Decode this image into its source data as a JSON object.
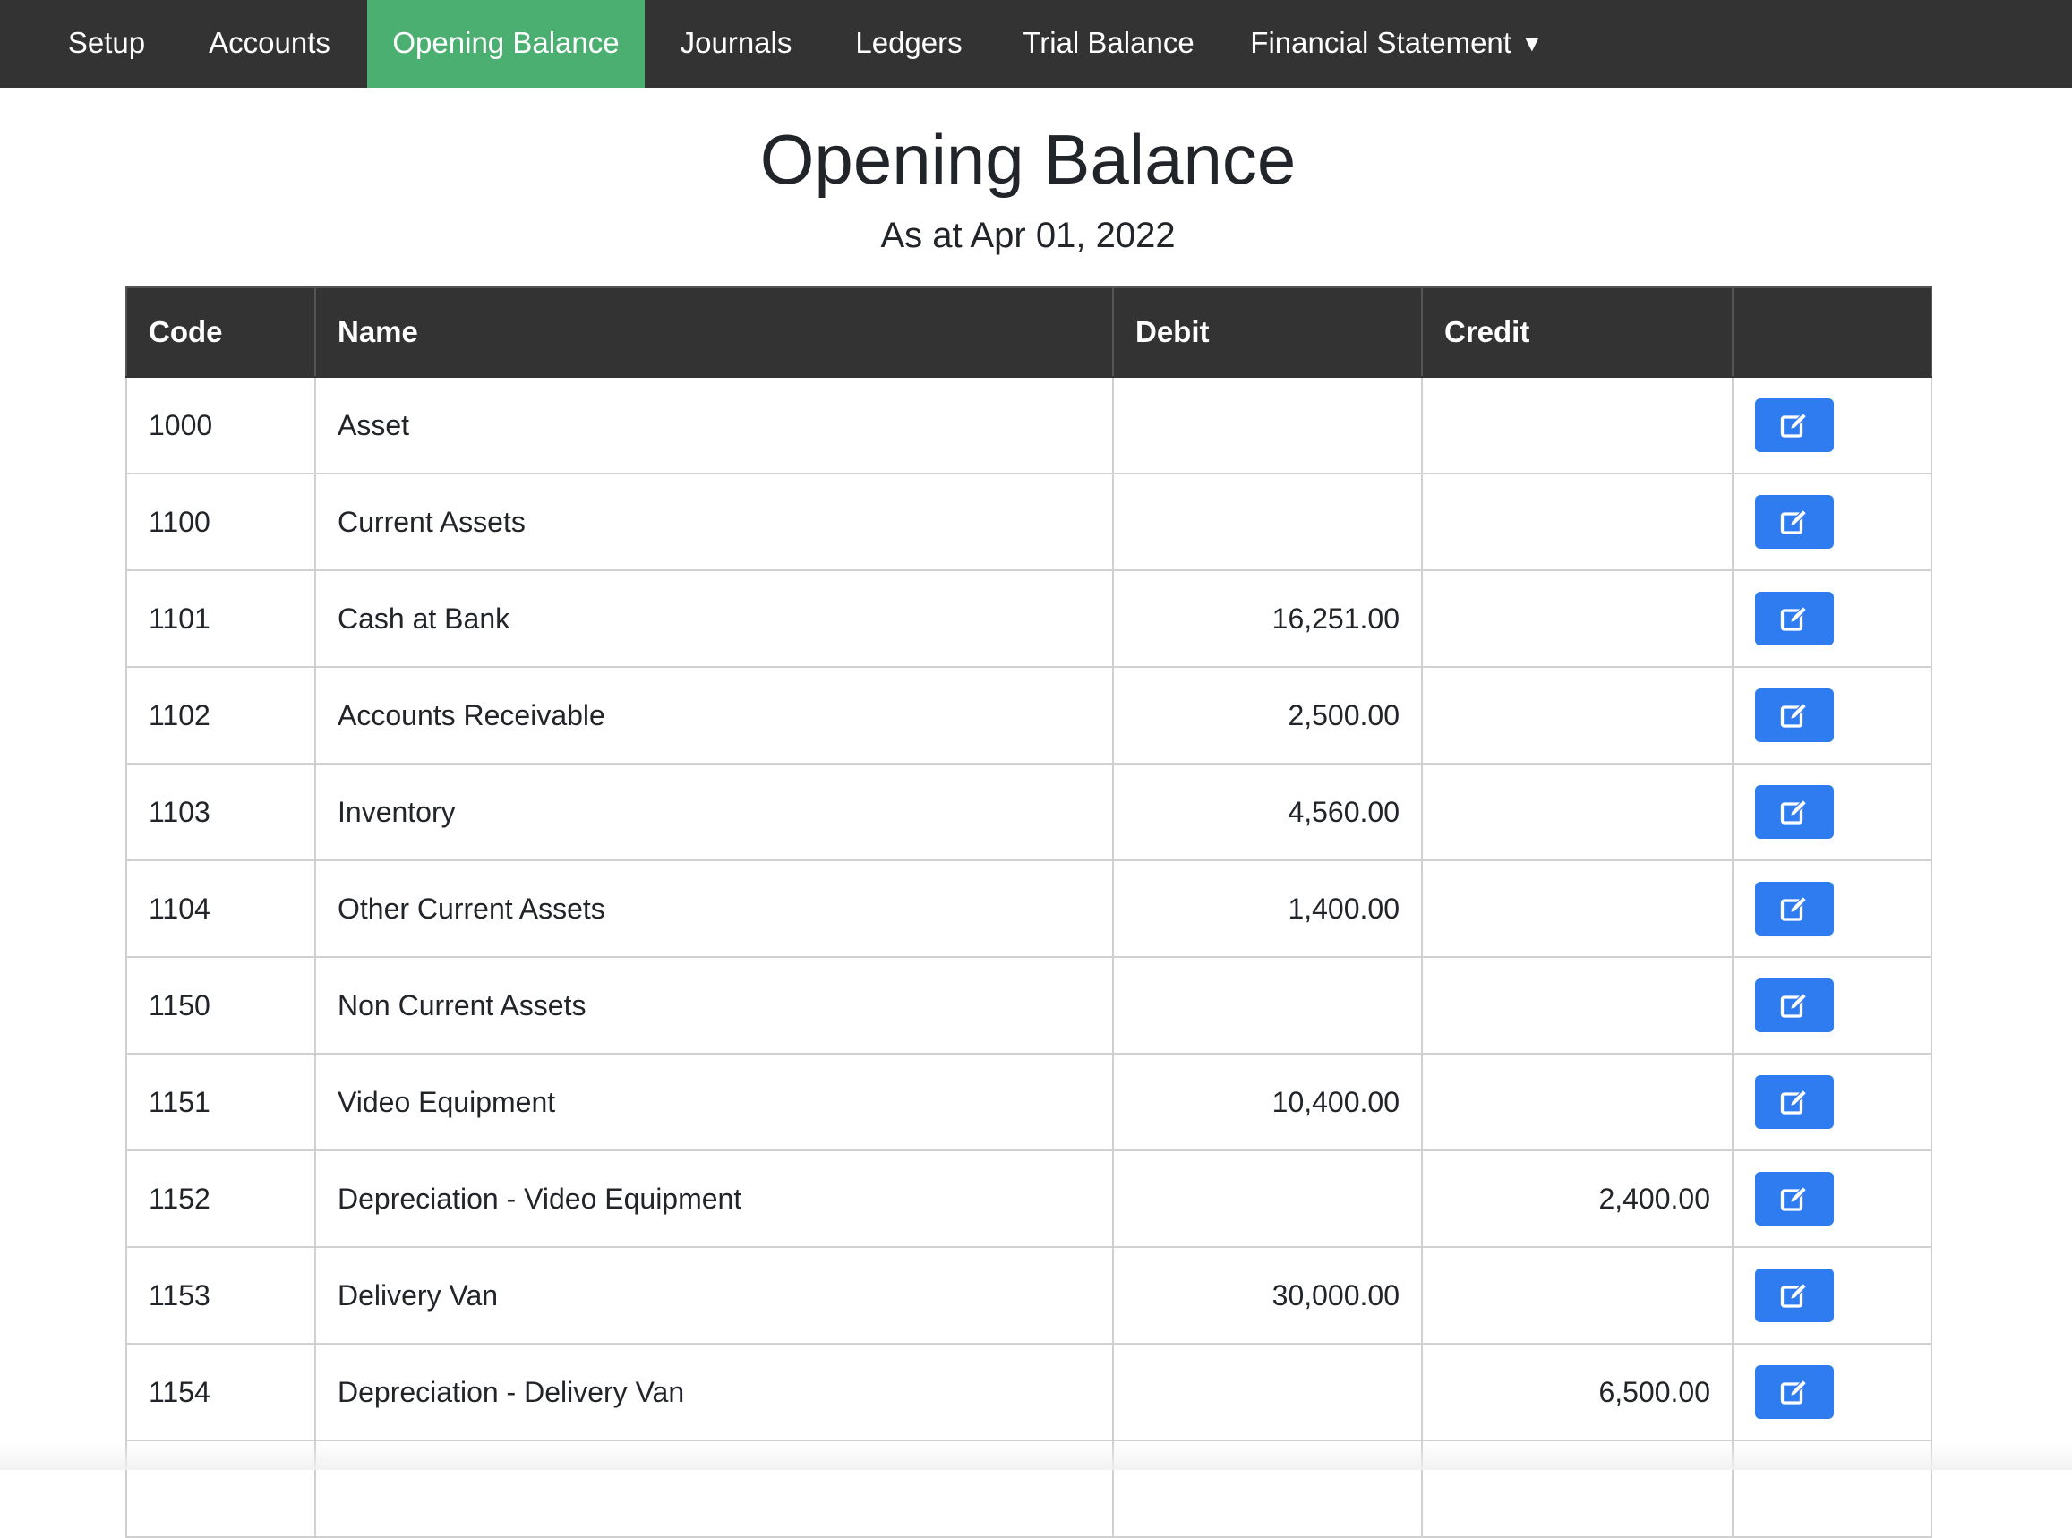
{
  "nav": {
    "items": [
      {
        "label": "Setup",
        "active": false
      },
      {
        "label": "Accounts",
        "active": false
      },
      {
        "label": "Opening Balance",
        "active": true
      },
      {
        "label": "Journals",
        "active": false
      },
      {
        "label": "Ledgers",
        "active": false
      },
      {
        "label": "Trial Balance",
        "active": false
      },
      {
        "label": "Financial Statement",
        "active": false,
        "dropdown": true
      }
    ],
    "caret": "▼",
    "colors": {
      "background": "#333333",
      "active": "#4caf72",
      "text": "#ffffff"
    }
  },
  "page": {
    "title": "Opening Balance",
    "subtitle": "As at Apr 01, 2022"
  },
  "table": {
    "headers": {
      "code": "Code",
      "name": "Name",
      "debit": "Debit",
      "credit": "Credit",
      "action": ""
    },
    "rows": [
      {
        "code": "1000",
        "name": "Asset",
        "debit": "",
        "credit": ""
      },
      {
        "code": "1100",
        "name": "Current Assets",
        "debit": "",
        "credit": ""
      },
      {
        "code": "1101",
        "name": "Cash at Bank",
        "debit": "16,251.00",
        "credit": ""
      },
      {
        "code": "1102",
        "name": "Accounts Receivable",
        "debit": "2,500.00",
        "credit": ""
      },
      {
        "code": "1103",
        "name": "Inventory",
        "debit": "4,560.00",
        "credit": ""
      },
      {
        "code": "1104",
        "name": "Other Current Assets",
        "debit": "1,400.00",
        "credit": ""
      },
      {
        "code": "1150",
        "name": "Non Current Assets",
        "debit": "",
        "credit": ""
      },
      {
        "code": "1151",
        "name": "Video Equipment",
        "debit": "10,400.00",
        "credit": ""
      },
      {
        "code": "1152",
        "name": "Depreciation - Video Equipment",
        "debit": "",
        "credit": "2,400.00"
      },
      {
        "code": "1153",
        "name": "Delivery Van",
        "debit": "30,000.00",
        "credit": ""
      },
      {
        "code": "1154",
        "name": "Depreciation - Delivery Van",
        "debit": "",
        "credit": "6,500.00"
      },
      {
        "code": "",
        "name": "",
        "debit": "",
        "credit": ""
      }
    ],
    "row_action_icon": "edit-icon",
    "action_color": "#2f7bf0"
  }
}
